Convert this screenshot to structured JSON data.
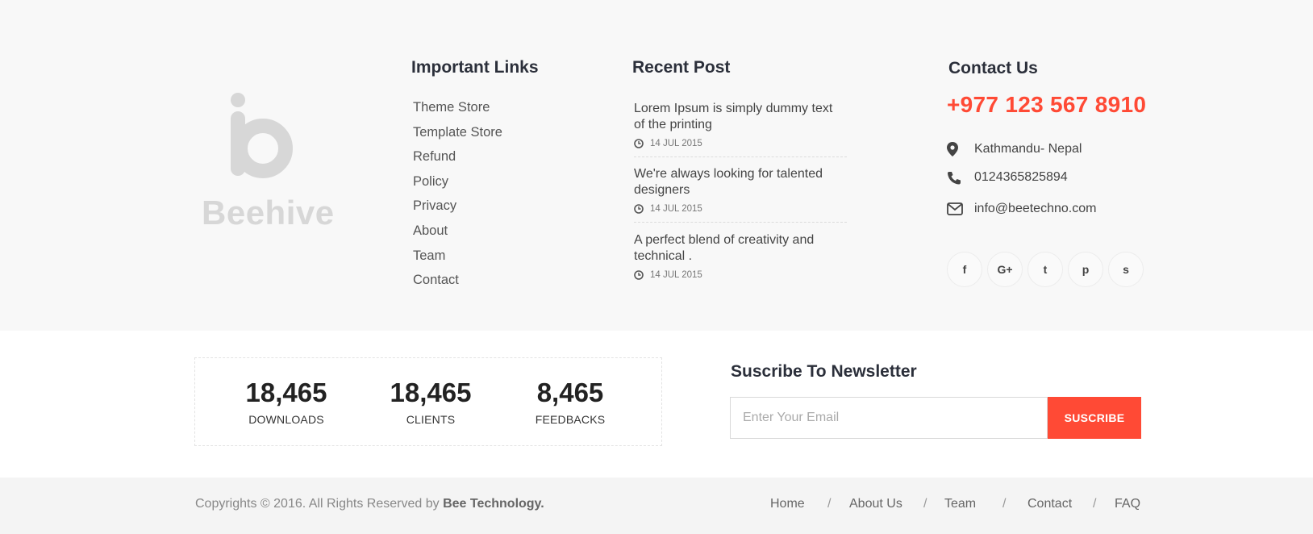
{
  "brand": {
    "logo_text": "Beehive"
  },
  "important_links": {
    "title": "Important  Links",
    "items": [
      "Theme Store",
      "Template Store",
      "Refund",
      "Policy",
      "Privacy",
      "About",
      "Team",
      "Contact"
    ]
  },
  "recent_post": {
    "title": "Recent Post",
    "posts": [
      {
        "title": "Lorem Ipsum is simply dummy text of the printing",
        "date": "14 JUL 2015"
      },
      {
        "title": "We're always looking for talented designers",
        "date": "14 JUL 2015"
      },
      {
        "title": "A perfect blend of creativity and technical .",
        "date": "14 JUL 2015"
      }
    ]
  },
  "contact": {
    "title": "Contact Us",
    "phone_big": "+977 123 567 8910",
    "address": "Kathmandu- Nepal",
    "phone": "0124365825894",
    "email": "info@beetechno.com",
    "address_icon": "map-marker-icon",
    "phone_icon": "phone-icon",
    "email_icon": "envelope-icon"
  },
  "socials": [
    {
      "icon": "facebook-icon",
      "glyph": "f"
    },
    {
      "icon": "google-plus-icon",
      "glyph": "G+"
    },
    {
      "icon": "twitter-icon",
      "glyph": "t"
    },
    {
      "icon": "pinterest-icon",
      "glyph": "p"
    },
    {
      "icon": "skype-icon",
      "glyph": "s"
    }
  ],
  "stats": [
    {
      "value": "18,465",
      "label": "DOWNLOADS"
    },
    {
      "value": "18,465",
      "label": "CLIENTS"
    },
    {
      "value": "8,465",
      "label": "FEEDBACKS"
    }
  ],
  "newsletter": {
    "title": "Suscribe To Newsletter",
    "placeholder": "Enter Your Email",
    "button": "SUSCRIBE"
  },
  "bottom": {
    "copyright": "Copyrights © 2016. All Rights Reserved by",
    "company": "Bee Technology.",
    "nav": [
      "Home",
      "About Us",
      "Team",
      "Contact",
      "FAQ"
    ],
    "separator": "/"
  },
  "colors": {
    "accent": "#ff4a35",
    "logo_gray": "#d7d7d7",
    "heading": "#2b2f3a"
  }
}
